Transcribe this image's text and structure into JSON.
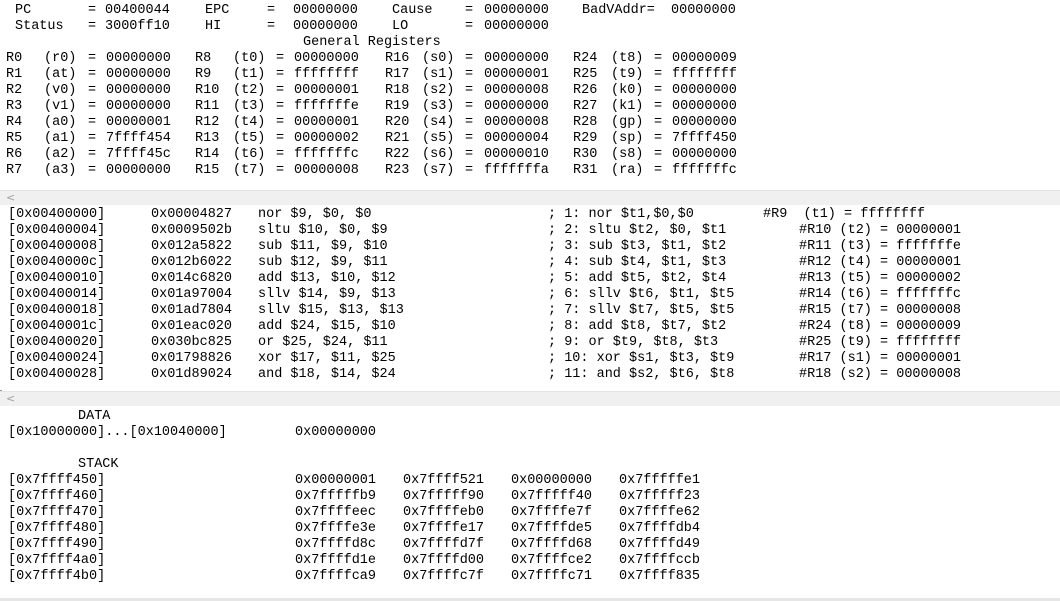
{
  "registers": {
    "special_rows": [
      [
        "PC",
        "=",
        "00400044",
        "EPC",
        "=",
        "00000000",
        "Cause",
        "=",
        "00000000",
        "BadVAddr=",
        "00000000"
      ],
      [
        "Status",
        "=",
        "3000ff10",
        "HI",
        "=",
        "00000000",
        "LO",
        "=",
        "00000000"
      ]
    ],
    "heading": "General Registers",
    "general_rows": [
      [
        "R0",
        "(r0)",
        "=",
        "00000000",
        "R8",
        "(t0)",
        "=",
        "00000000",
        "R16",
        "(s0)",
        "=",
        "00000000",
        "R24",
        "(t8)",
        "=",
        "00000009"
      ],
      [
        "R1",
        "(at)",
        "=",
        "00000000",
        "R9",
        "(t1)",
        "=",
        "ffffffff",
        "R17",
        "(s1)",
        "=",
        "00000001",
        "R25",
        "(t9)",
        "=",
        "ffffffff"
      ],
      [
        "R2",
        "(v0)",
        "=",
        "00000000",
        "R10",
        "(t2)",
        "=",
        "00000001",
        "R18",
        "(s2)",
        "=",
        "00000008",
        "R26",
        "(k0)",
        "=",
        "00000000"
      ],
      [
        "R3",
        "(v1)",
        "=",
        "00000000",
        "R11",
        "(t3)",
        "=",
        "fffffffe",
        "R19",
        "(s3)",
        "=",
        "00000000",
        "R27",
        "(k1)",
        "=",
        "00000000"
      ],
      [
        "R4",
        "(a0)",
        "=",
        "00000001",
        "R12",
        "(t4)",
        "=",
        "00000001",
        "R20",
        "(s4)",
        "=",
        "00000008",
        "R28",
        "(gp)",
        "=",
        "00000000"
      ],
      [
        "R5",
        "(a1)",
        "=",
        "7ffff454",
        "R13",
        "(t5)",
        "=",
        "00000002",
        "R21",
        "(s5)",
        "=",
        "00000004",
        "R29",
        "(sp)",
        "=",
        "7ffff450"
      ],
      [
        "R6",
        "(a2)",
        "=",
        "7ffff45c",
        "R14",
        "(t6)",
        "=",
        "fffffffc",
        "R22",
        "(s6)",
        "=",
        "00000010",
        "R30",
        "(s8)",
        "=",
        "00000000"
      ],
      [
        "R7",
        "(a3)",
        "=",
        "00000000",
        "R15",
        "(t7)",
        "=",
        "00000008",
        "R23",
        "(s7)",
        "=",
        "fffffffa",
        "R31",
        "(ra)",
        "=",
        "fffffffc"
      ]
    ]
  },
  "text_segment": {
    "rows": [
      [
        "[0x00400000]",
        "0x00004827",
        "nor $9, $0, $0",
        "; 1: nor $t1,$0,$0",
        "#R9  (t1) = ffffffff"
      ],
      [
        "[0x00400004]",
        "0x0009502b",
        "sltu $10, $0, $9",
        "; 2: sltu $t2, $0, $t1",
        "#R10 (t2) = 00000001"
      ],
      [
        "[0x00400008]",
        "0x012a5822",
        "sub $11, $9, $10",
        "; 3: sub $t3, $t1, $t2",
        "#R11 (t3) = fffffffe"
      ],
      [
        "[0x0040000c]",
        "0x012b6022",
        "sub $12, $9, $11",
        "; 4: sub $t4, $t1, $t3",
        "#R12 (t4) = 00000001"
      ],
      [
        "[0x00400010]",
        "0x014c6820",
        "add $13, $10, $12",
        "; 5: add $t5, $t2, $t4",
        "#R13 (t5) = 00000002"
      ],
      [
        "[0x00400014]",
        "0x01a97004",
        "sllv $14, $9, $13",
        "; 6: sllv $t6, $t1, $t5",
        "#R14 (t6) = fffffffc"
      ],
      [
        "[0x00400018]",
        "0x01ad7804",
        "sllv $15, $13, $13",
        "; 7: sllv $t7, $t5, $t5",
        "#R15 (t7) = 00000008"
      ],
      [
        "[0x0040001c]",
        "0x01eac020",
        "add $24, $15, $10",
        "; 8: add $t8, $t7, $t2",
        "#R24 (t8) = 00000009"
      ],
      [
        "[0x00400020]",
        "0x030bc825",
        "or $25, $24, $11",
        "; 9: or $t9, $t8, $t3",
        "#R25 (t9) = ffffffff"
      ],
      [
        "[0x00400024]",
        "0x01798826",
        "xor $17, $11, $25",
        "; 10: xor $s1, $t3, $t9",
        "#R17 (s1) = 00000001"
      ],
      [
        "[0x00400028]",
        "0x01d89024",
        "and $18, $14, $24",
        "; 11: and $s2, $t6, $t8",
        "#R18 (s2) = 00000008"
      ]
    ]
  },
  "data_segment": {
    "data_heading": "DATA",
    "data_row": [
      "[0x10000000]...[0x10040000]",
      "0x00000000"
    ],
    "stack_heading": "STACK",
    "stack_rows": [
      [
        "[0x7ffff450]",
        "0x00000001",
        "0x7ffff521",
        "0x00000000",
        "0x7fffffe1"
      ],
      [
        "[0x7ffff460]",
        "0x7fffffb9",
        "0x7fffff90",
        "0x7fffff40",
        "0x7fffff23"
      ],
      [
        "[0x7ffff470]",
        "0x7ffffeec",
        "0x7ffffeb0",
        "0x7ffffe7f",
        "0x7ffffe62"
      ],
      [
        "[0x7ffff480]",
        "0x7ffffe3e",
        "0x7ffffe17",
        "0x7ffffde5",
        "0x7ffffdb4"
      ],
      [
        "[0x7ffff490]",
        "0x7ffffd8c",
        "0x7ffffd7f",
        "0x7ffffd68",
        "0x7ffffd49"
      ],
      [
        "[0x7ffff4a0]",
        "0x7ffffd1e",
        "0x7ffffd00",
        "0x7ffffce2",
        "0x7ffffccb"
      ],
      [
        "[0x7ffff4b0]",
        "0x7ffffca9",
        "0x7ffffc7f",
        "0x7ffffc71",
        "0x7ffff835"
      ]
    ]
  },
  "scrollbars": {
    "arrow_glyph": "<"
  },
  "colors": {
    "background": "#ffffff",
    "scrollbar": "#f0f0f0",
    "text": "#000000"
  }
}
